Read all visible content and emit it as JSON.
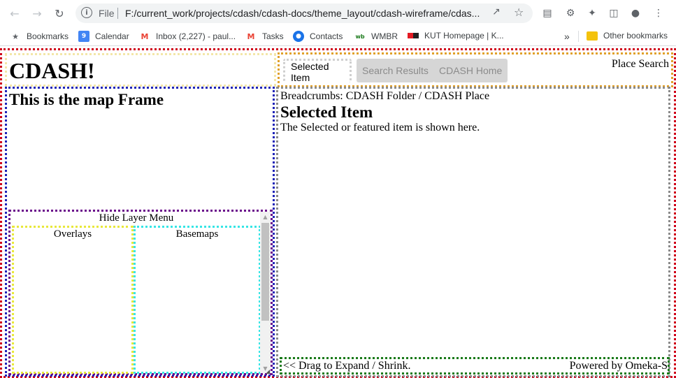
{
  "browser": {
    "back_icon": "arrow-left-icon",
    "forward_icon": "arrow-right-icon",
    "reload_icon": "reload-icon",
    "omnibox": {
      "scheme_label": "File",
      "url": "F:/current_work/projects/cdash/cdash-docs/theme_layout/cdash-wireframe/cdas..."
    },
    "bookmarks": [
      {
        "label": "Bookmarks",
        "icon": "star-icon"
      },
      {
        "label": "Calendar",
        "icon": "calendar-icon"
      },
      {
        "label": "Inbox (2,227) - paul...",
        "icon": "gmail-icon"
      },
      {
        "label": "Tasks",
        "icon": "gmail-icon"
      },
      {
        "label": "Contacts",
        "icon": "contacts-icon"
      },
      {
        "label": "WMBR",
        "icon": "wmbr-icon"
      },
      {
        "label": "KUT Homepage | K...",
        "icon": "kut-icon"
      }
    ],
    "overflow_label": "»",
    "other_bookmarks": "Other bookmarks"
  },
  "page": {
    "site_title": "CDASH!",
    "tabs": [
      {
        "label": "Selected Item",
        "active": true
      },
      {
        "label": "Search Results",
        "active": false
      },
      {
        "label": "CDASH Home",
        "active": false
      }
    ],
    "place_search": "Place Search",
    "map": {
      "title": "This is the map Frame",
      "layer_menu_toggle": "Hide Layer Menu",
      "overlays_label": "Overlays",
      "basemaps_label": "Basemaps"
    },
    "content": {
      "breadcrumbs": "Breadcrumbs: CDASH Folder / CDASH Place",
      "heading": "Selected Item",
      "description": "The Selected or featured item is shown here."
    },
    "footer": {
      "drag_label": "<< Drag to Expand / Shrink.",
      "powered_by": "Powered by Omeka-S"
    }
  }
}
